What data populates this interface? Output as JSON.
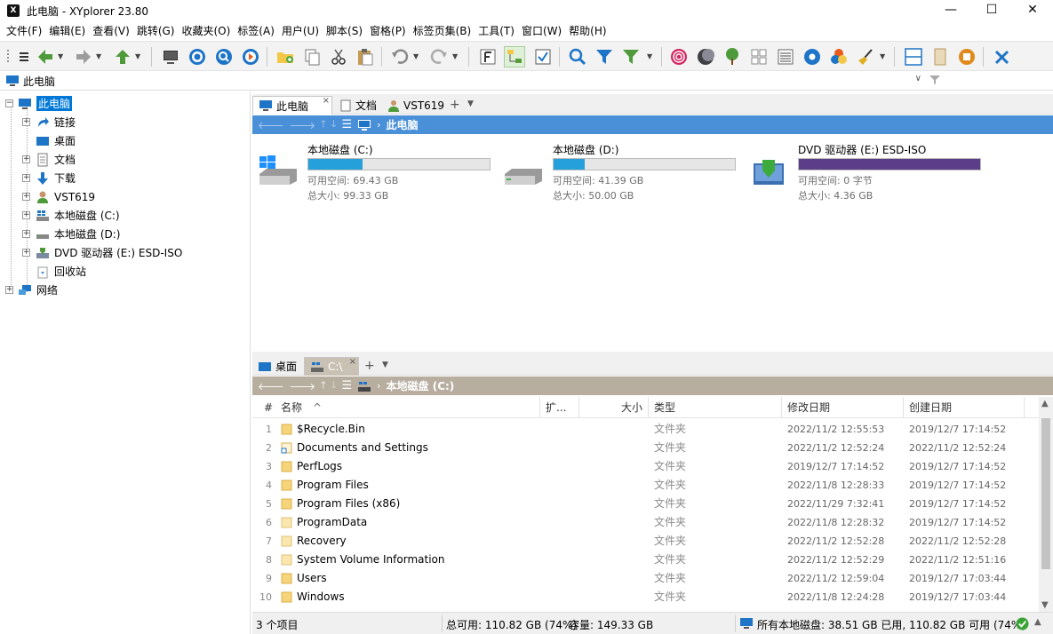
{
  "window": {
    "title": "此电脑 - XYplorer 23.80",
    "app_icon_text": "X",
    "minimize": "—",
    "maximize": "☐",
    "close": "✕"
  },
  "menu": [
    "文件(F)",
    "编辑(E)",
    "查看(V)",
    "跳转(G)",
    "收藏夹(O)",
    "标签(A)",
    "用户(U)",
    "脚本(S)",
    "窗格(P)",
    "标签页集(B)",
    "工具(T)",
    "窗口(W)",
    "帮助(H)"
  ],
  "address": {
    "value": "此电脑"
  },
  "tree": {
    "root": "此电脑",
    "items": [
      "链接",
      "桌面",
      "文档",
      "下载",
      "VST619",
      "本地磁盘 (C:)",
      "本地磁盘 (D:)",
      "DVD 驱动器 (E:) ESD-ISO",
      "回收站"
    ],
    "network": "网络"
  },
  "pane1": {
    "tabs": [
      "此电脑",
      "文档",
      "VST619"
    ],
    "crumb": "此电脑",
    "drives": [
      {
        "name": "本地磁盘 (C:)",
        "free": "可用空间: 69.43 GB",
        "total": "总大小: 99.33 GB",
        "used_fraction": 0.3,
        "color": "#26a0da"
      },
      {
        "name": "本地磁盘 (D:)",
        "free": "可用空间: 41.39 GB",
        "total": "总大小: 50.00 GB",
        "used_fraction": 0.17,
        "color": "#26a0da"
      },
      {
        "name": "DVD 驱动器 (E:) ESD-ISO",
        "free": "可用空间: 0 字节",
        "total": "总大小: 4.36 GB",
        "used_fraction": 1.0,
        "color": "#5c3d8a"
      }
    ]
  },
  "pane2": {
    "tabs": [
      "桌面",
      "C:\\"
    ],
    "crumb": "本地磁盘 (C:)",
    "columns": {
      "num": "#",
      "name": "名称",
      "ext": "扩...",
      "size": "大小",
      "type": "类型",
      "modified": "修改日期",
      "created": "创建日期"
    },
    "rows": [
      {
        "n": "1",
        "name": "$Recycle.Bin",
        "type": "文件夹",
        "mod": "2022/11/2 12:55:53",
        "cre": "2019/12/7 17:14:52"
      },
      {
        "n": "2",
        "name": "Documents and Settings",
        "type": "文件夹",
        "mod": "2022/11/2 12:52:24",
        "cre": "2022/11/2 12:52:24"
      },
      {
        "n": "3",
        "name": "PerfLogs",
        "type": "文件夹",
        "mod": "2019/12/7 17:14:52",
        "cre": "2019/12/7 17:14:52"
      },
      {
        "n": "4",
        "name": "Program Files",
        "type": "文件夹",
        "mod": "2022/11/8 12:28:33",
        "cre": "2019/12/7 17:14:52"
      },
      {
        "n": "5",
        "name": "Program Files (x86)",
        "type": "文件夹",
        "mod": "2022/11/29 7:32:41",
        "cre": "2019/12/7 17:14:52"
      },
      {
        "n": "6",
        "name": "ProgramData",
        "type": "文件夹",
        "mod": "2022/11/8 12:28:32",
        "cre": "2019/12/7 17:14:52"
      },
      {
        "n": "7",
        "name": "Recovery",
        "type": "文件夹",
        "mod": "2022/11/2 12:52:28",
        "cre": "2022/11/2 12:52:28"
      },
      {
        "n": "8",
        "name": "System Volume Information",
        "type": "文件夹",
        "mod": "2022/11/2 12:52:29",
        "cre": "2022/11/2 12:51:16"
      },
      {
        "n": "9",
        "name": "Users",
        "type": "文件夹",
        "mod": "2022/11/2 12:59:04",
        "cre": "2019/12/7 17:03:44"
      },
      {
        "n": "10",
        "name": "Windows",
        "type": "文件夹",
        "mod": "2022/11/8 12:24:28",
        "cre": "2019/12/7 17:03:44"
      }
    ]
  },
  "status": {
    "items": "3 个项目",
    "free": "总可用: 110.82 GB (74%)",
    "capacity": "容量: 149.33 GB",
    "all_drives": "所有本地磁盘: 38.51 GB 已用, 110.82 GB 可用 (74%)"
  }
}
